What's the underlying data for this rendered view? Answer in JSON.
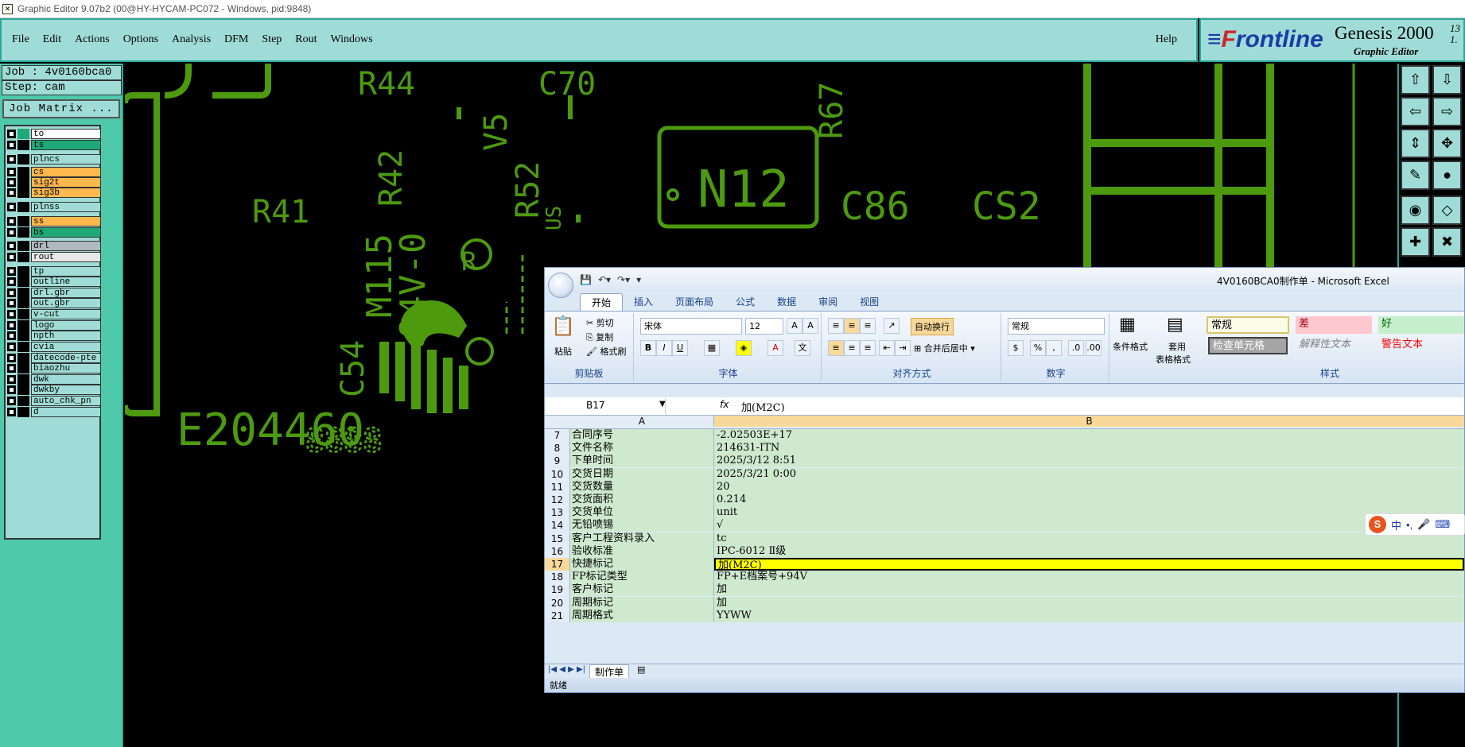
{
  "window": {
    "title": "Graphic Editor 9.07b2 (00@HY-HYCAM-PC072 - Windows, pid:9848)"
  },
  "menu": {
    "items": [
      "File",
      "Edit",
      "Actions",
      "Options",
      "Analysis",
      "DFM",
      "Step",
      "Rout",
      "Windows"
    ],
    "help": "Help"
  },
  "brand": {
    "logo_f": "F",
    "logo_rest": "rontline",
    "product": "Genesis 2000",
    "subtitle": "Graphic Editor",
    "version_a": "13",
    "version_b": "1."
  },
  "job": {
    "job_line": "Job : 4v0160bca0",
    "step_line": "Step: cam",
    "matrix_label": "Job Matrix ..."
  },
  "layers": [
    {
      "name": "to",
      "color": "#ffffff"
    },
    {
      "name": "ts",
      "color": "#1fa878"
    },
    {
      "name": "plncs",
      "color": "#a0dcd7"
    },
    {
      "name": "cs",
      "color": "#ffb84d"
    },
    {
      "name": "sig2t",
      "color": "#ffb84d"
    },
    {
      "name": "sig3b",
      "color": "#ffb84d"
    },
    {
      "name": "plnss",
      "color": "#a0dcd7"
    },
    {
      "name": "ss",
      "color": "#ffb84d"
    },
    {
      "name": "bs",
      "color": "#1fa878"
    },
    {
      "name": "drl",
      "color": "#b0b8c0"
    },
    {
      "name": "rout",
      "color": "#e8e8e8"
    },
    {
      "name": "tp",
      "color": "#a0dcd7"
    },
    {
      "name": "outline",
      "color": "#a0dcd7"
    },
    {
      "name": "drl.gbr",
      "color": "#a0dcd7"
    },
    {
      "name": "out.gbr",
      "color": "#a0dcd7"
    },
    {
      "name": "v-cut",
      "color": "#a0dcd7"
    },
    {
      "name": "logo",
      "color": "#a0dcd7"
    },
    {
      "name": "npth",
      "color": "#a0dcd7"
    },
    {
      "name": "cvia",
      "color": "#a0dcd7"
    },
    {
      "name": "datecode-pte",
      "color": "#a0dcd7"
    },
    {
      "name": "biaozhu",
      "color": "#a0dcd7"
    },
    {
      "name": "dwk",
      "color": "#a0dcd7"
    },
    {
      "name": "dwkby",
      "color": "#a0dcd7"
    },
    {
      "name": "auto_chk_pn",
      "color": "#a0dcd7"
    },
    {
      "name": "d",
      "color": "#a0dcd7"
    }
  ],
  "pcb": {
    "labels": [
      "R44",
      "C70",
      "R67",
      "R41",
      "R42",
      "V5",
      "R52",
      "N12",
      "C86",
      "CS2",
      "M115",
      "94V-0",
      "C54",
      "E204460",
      "8888",
      "US",
      "R"
    ]
  },
  "colors": {
    "pcb_green": "#4d9a0f",
    "panel_teal": "#a0dcd7",
    "panel_dark": "#4ec9aa",
    "excel_cell": "#cfe9cf",
    "highlight": "#ffff00"
  },
  "excel": {
    "title": "4V0160BCA0制作单 - Microsoft Excel",
    "tabs": [
      "开始",
      "插入",
      "页面布局",
      "公式",
      "数据",
      "审阅",
      "视图"
    ],
    "clipboard": {
      "paste": "粘贴",
      "cut": "剪切",
      "copy": "复制",
      "format_painter": "格式刷",
      "label": "剪贴板"
    },
    "font": {
      "name": "宋体",
      "size": "12",
      "label": "字体"
    },
    "alignment": {
      "wrap": "自动换行",
      "merge": "合并后居中",
      "label": "对齐方式"
    },
    "number": {
      "format": "常规",
      "label": "数字"
    },
    "styles": {
      "conditional": "条件格式",
      "table": "套用",
      "table2": "表格格式",
      "normal": "常规",
      "bad": "差",
      "good": "好",
      "check": "检查单元格",
      "explain": "解释性文本",
      "warning": "警告文本",
      "label": "样式"
    },
    "name_box": "B17",
    "fx": "fx",
    "formula": "加(M2C)",
    "col_a": "A",
    "col_b": "B",
    "rows": [
      {
        "n": "7",
        "a": "合同序号",
        "b": "-2.02503E+17"
      },
      {
        "n": "8",
        "a": "文件名称",
        "b": "214631-ITN"
      },
      {
        "n": "9",
        "a": "下单时间",
        "b": "2025/3/12 8:51"
      },
      {
        "n": "10",
        "a": "交货日期",
        "b": "2025/3/21 0:00"
      },
      {
        "n": "11",
        "a": "交货数量",
        "b": "20"
      },
      {
        "n": "12",
        "a": "交货面积",
        "b": "0.214"
      },
      {
        "n": "13",
        "a": "交货单位",
        "b": "unit"
      },
      {
        "n": "14",
        "a": "无铅喷锡",
        "b": "√"
      },
      {
        "n": "15",
        "a": "客户工程资料录入",
        "b": "tc"
      },
      {
        "n": "16",
        "a": "验收标准",
        "b": "IPC-6012 Ⅱ级"
      },
      {
        "n": "17",
        "a": "快捷标记",
        "b": "加(M2C)"
      },
      {
        "n": "18",
        "a": "FP标记类型",
        "b": "FP+E档案号+94V"
      },
      {
        "n": "19",
        "a": "客户标记",
        "b": "加"
      },
      {
        "n": "20",
        "a": "周期标记",
        "b": "加"
      },
      {
        "n": "21",
        "a": "周期格式",
        "b": "YYWW"
      }
    ],
    "selected_row": "17",
    "sheet_tab": "制作单",
    "status": "就绪"
  },
  "ime": {
    "label": "中",
    "logo": "S"
  }
}
